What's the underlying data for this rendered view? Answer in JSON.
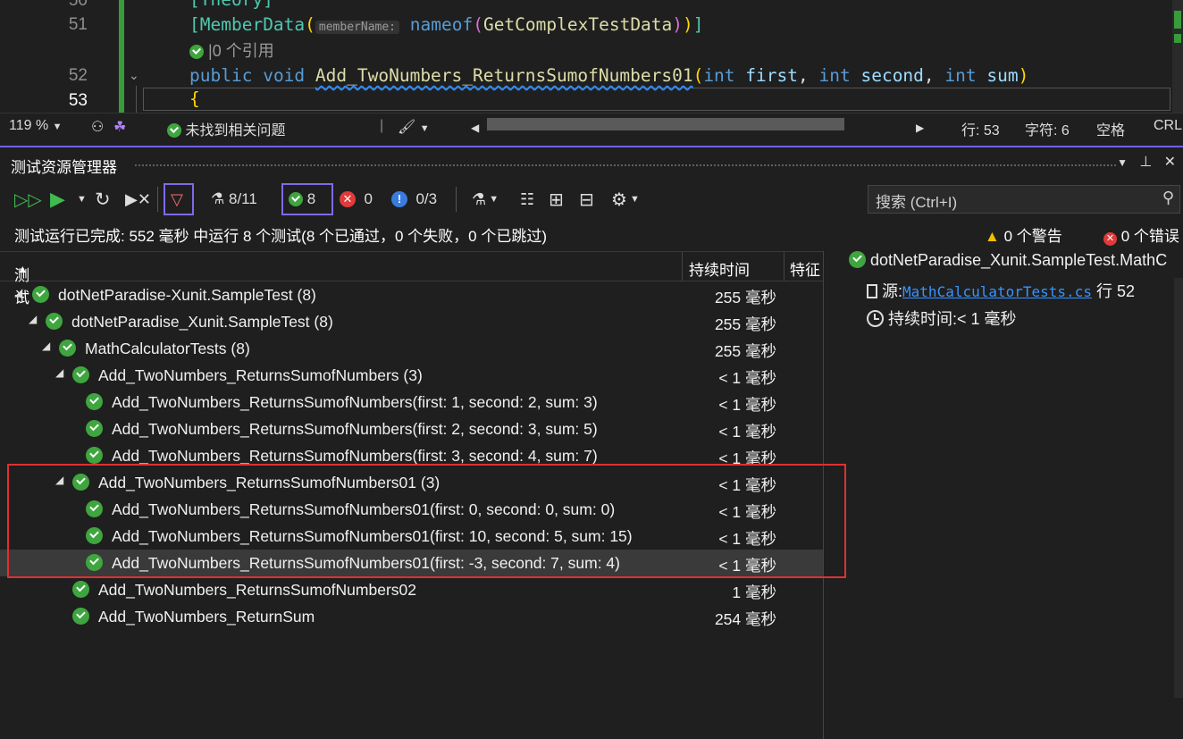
{
  "editor": {
    "lines": [
      {
        "num": "50",
        "text": "[Theory]"
      },
      {
        "num": "51",
        "attr_name": "MemberData",
        "hint": "memberName:",
        "arg_kw": "nameof",
        "arg": "GetComplexTestData"
      },
      {
        "codelens": "0 个引用"
      },
      {
        "num": "52",
        "kw1": "public",
        "kw2": "void",
        "method": "Add_TwoNumbers_ReturnsSumofNumbers01",
        "p1t": "int",
        "p1": "first",
        "p2t": "int",
        "p2": "second",
        "p3t": "int",
        "p3": "sum"
      },
      {
        "num": "53",
        "text": "{"
      }
    ]
  },
  "statusbar": {
    "zoom": "119 %",
    "issues": "未找到相关问题",
    "line": "行: 53",
    "char": "字符: 6",
    "spacing": "空格",
    "eol": "CRLF"
  },
  "panel": {
    "title": "测试资源管理器",
    "toolbar": {
      "total": "8/11",
      "passed": "8",
      "failed": "0",
      "skipped": "0/3"
    },
    "search_placeholder": "搜索 (Ctrl+I)",
    "summary": "测试运行已完成: 552 毫秒 中运行 8 个测试(8 个已通过，0 个失败，0 个已跳过)",
    "warnings": "0 个警告",
    "errors": "0 个错误"
  },
  "tree": {
    "columns": {
      "test": "测试",
      "duration": "持续时间",
      "traits": "特征"
    },
    "rows": [
      {
        "name": "dotNetParadise-Xunit.SampleTest  (8)",
        "duration": "255 毫秒"
      },
      {
        "name": "dotNetParadise_Xunit.SampleTest  (8)",
        "duration": "255 毫秒"
      },
      {
        "name": "MathCalculatorTests  (8)",
        "duration": "255 毫秒"
      },
      {
        "name": "Add_TwoNumbers_ReturnsSumofNumbers  (3)",
        "duration": "< 1 毫秒"
      },
      {
        "name": "Add_TwoNumbers_ReturnsSumofNumbers(first: 1, second: 2, sum: 3)",
        "duration": "< 1 毫秒"
      },
      {
        "name": "Add_TwoNumbers_ReturnsSumofNumbers(first: 2, second: 3, sum: 5)",
        "duration": "< 1 毫秒"
      },
      {
        "name": "Add_TwoNumbers_ReturnsSumofNumbers(first: 3, second: 4, sum: 7)",
        "duration": "< 1 毫秒"
      },
      {
        "name": "Add_TwoNumbers_ReturnsSumofNumbers01  (3)",
        "duration": "< 1 毫秒"
      },
      {
        "name": "Add_TwoNumbers_ReturnsSumofNumbers01(first: 0, second: 0, sum: 0)",
        "duration": "< 1 毫秒"
      },
      {
        "name": "Add_TwoNumbers_ReturnsSumofNumbers01(first: 10, second: 5, sum: 15)",
        "duration": "< 1 毫秒"
      },
      {
        "name": "Add_TwoNumbers_ReturnsSumofNumbers01(first: -3, second: 7, sum: 4)",
        "duration": "< 1 毫秒"
      },
      {
        "name": "Add_TwoNumbers_ReturnsSumofNumbers02",
        "duration": "1 毫秒"
      },
      {
        "name": "Add_TwoNumbers_ReturnSum",
        "duration": "254 毫秒"
      }
    ]
  },
  "details": {
    "title": "dotNetParadise_Xunit.SampleTest.MathC",
    "source_label": "源:",
    "source_file": "MathCalculatorTests.cs",
    "source_line": "行 52",
    "duration_label": "持续时间:",
    "duration_value": "< 1 毫秒"
  }
}
